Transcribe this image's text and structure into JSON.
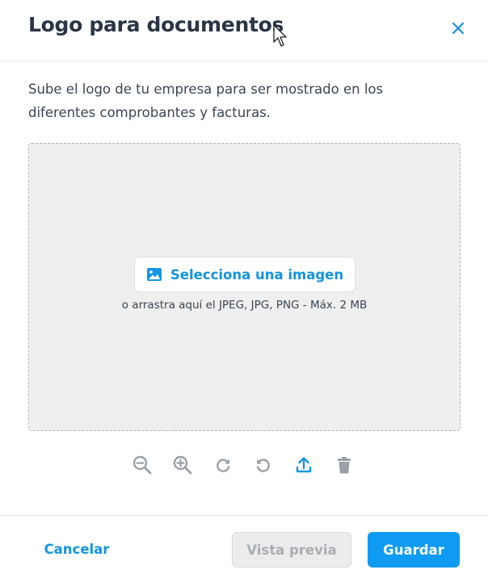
{
  "dialog": {
    "title": "Logo para documentos",
    "description": "Sube el logo de tu empresa para ser mostrado en los diferentes comprobantes y facturas."
  },
  "dropzone": {
    "select_label": "Selecciona una imagen",
    "hint": "o arrastra aquí el JPEG, JPG, PNG - Máx. 2 MB"
  },
  "toolbar": {
    "icons": [
      "zoom-out-icon",
      "zoom-in-icon",
      "rotate-right-icon",
      "rotate-left-icon",
      "upload-icon",
      "trash-icon"
    ]
  },
  "footer": {
    "cancel_label": "Cancelar",
    "preview_label": "Vista previa",
    "save_label": "Guardar"
  },
  "colors": {
    "accent": "#0f9bf2",
    "link": "#1395e0",
    "text": "#2a3545",
    "icon_gray": "#9aa0a6",
    "disabled_bg": "#ececec"
  }
}
